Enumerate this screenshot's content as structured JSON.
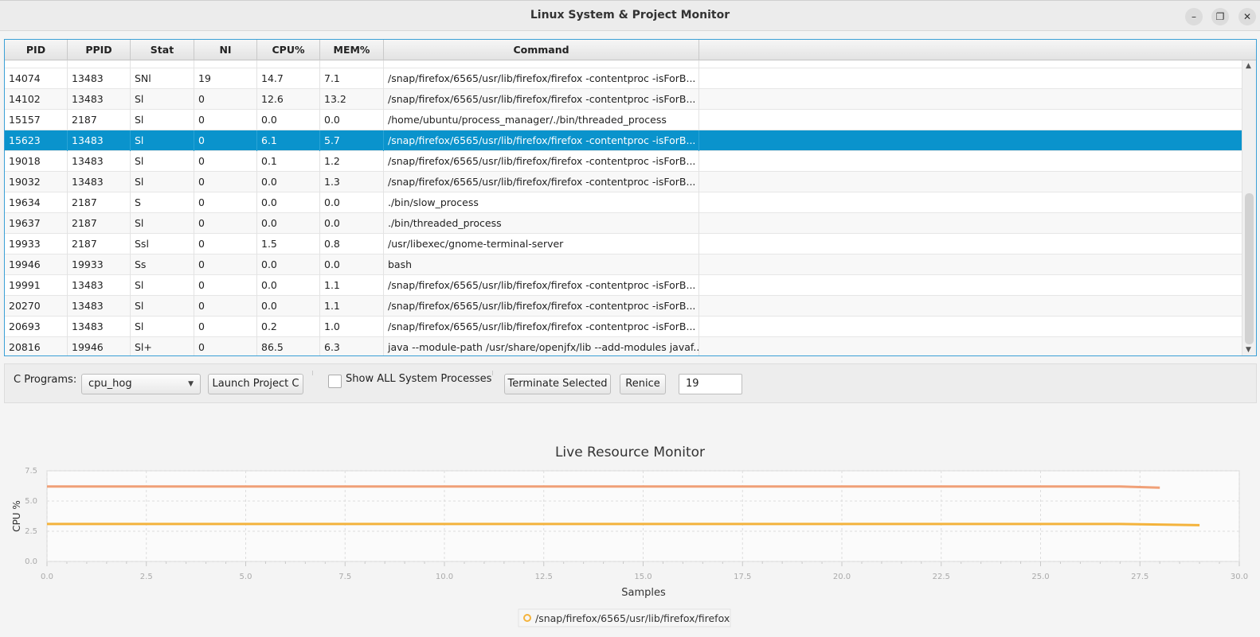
{
  "window": {
    "title": "Linux System & Project Monitor",
    "minimize_glyph": "–",
    "maximize_glyph": "❐",
    "close_glyph": "✕"
  },
  "table": {
    "columns": [
      "PID",
      "PPID",
      "Stat",
      "NI",
      "CPU%",
      "MEM%",
      "Command"
    ],
    "rows": [
      {
        "pid": "14074",
        "ppid": "13483",
        "stat": "SNl",
        "ni": "19",
        "cpu": "14.7",
        "mem": "7.1",
        "cmd": "/snap/firefox/6565/usr/lib/firefox/firefox -contentproc -isForB..."
      },
      {
        "pid": "14102",
        "ppid": "13483",
        "stat": "Sl",
        "ni": "0",
        "cpu": "12.6",
        "mem": "13.2",
        "cmd": "/snap/firefox/6565/usr/lib/firefox/firefox -contentproc -isForB..."
      },
      {
        "pid": "15157",
        "ppid": "2187",
        "stat": "Sl",
        "ni": "0",
        "cpu": "0.0",
        "mem": "0.0",
        "cmd": "/home/ubuntu/process_manager/./bin/threaded_process"
      },
      {
        "pid": "15623",
        "ppid": "13483",
        "stat": "Sl",
        "ni": "0",
        "cpu": "6.1",
        "mem": "5.7",
        "cmd": "/snap/firefox/6565/usr/lib/firefox/firefox -contentproc -isForB..."
      },
      {
        "pid": "19018",
        "ppid": "13483",
        "stat": "Sl",
        "ni": "0",
        "cpu": "0.1",
        "mem": "1.2",
        "cmd": "/snap/firefox/6565/usr/lib/firefox/firefox -contentproc -isForB..."
      },
      {
        "pid": "19032",
        "ppid": "13483",
        "stat": "Sl",
        "ni": "0",
        "cpu": "0.0",
        "mem": "1.3",
        "cmd": "/snap/firefox/6565/usr/lib/firefox/firefox -contentproc -isForB..."
      },
      {
        "pid": "19634",
        "ppid": "2187",
        "stat": "S",
        "ni": "0",
        "cpu": "0.0",
        "mem": "0.0",
        "cmd": "./bin/slow_process"
      },
      {
        "pid": "19637",
        "ppid": "2187",
        "stat": "Sl",
        "ni": "0",
        "cpu": "0.0",
        "mem": "0.0",
        "cmd": "./bin/threaded_process"
      },
      {
        "pid": "19933",
        "ppid": "2187",
        "stat": "Ssl",
        "ni": "0",
        "cpu": "1.5",
        "mem": "0.8",
        "cmd": "/usr/libexec/gnome-terminal-server"
      },
      {
        "pid": "19946",
        "ppid": "19933",
        "stat": "Ss",
        "ni": "0",
        "cpu": "0.0",
        "mem": "0.0",
        "cmd": "bash"
      },
      {
        "pid": "19991",
        "ppid": "13483",
        "stat": "Sl",
        "ni": "0",
        "cpu": "0.0",
        "mem": "1.1",
        "cmd": "/snap/firefox/6565/usr/lib/firefox/firefox -contentproc -isForB..."
      },
      {
        "pid": "20270",
        "ppid": "13483",
        "stat": "Sl",
        "ni": "0",
        "cpu": "0.0",
        "mem": "1.1",
        "cmd": "/snap/firefox/6565/usr/lib/firefox/firefox -contentproc -isForB..."
      },
      {
        "pid": "20693",
        "ppid": "13483",
        "stat": "Sl",
        "ni": "0",
        "cpu": "0.2",
        "mem": "1.0",
        "cmd": "/snap/firefox/6565/usr/lib/firefox/firefox -contentproc -isForB..."
      },
      {
        "pid": "20816",
        "ppid": "19946",
        "stat": "Sl+",
        "ni": "0",
        "cpu": "86.5",
        "mem": "6.3",
        "cmd": "java --module-path /usr/share/openjfx/lib --add-modules javaf..."
      }
    ],
    "selected_pid": "15623",
    "accent_color": "#0a93cc"
  },
  "controls": {
    "programs_label": "C Programs:",
    "program_selected": "cpu_hog",
    "launch_label": "Launch Project C",
    "show_all_label": "Show ALL System Processes",
    "show_all_checked": false,
    "terminate_label": "Terminate Selected",
    "renice_label": "Renice",
    "renice_value": "19"
  },
  "chart_data": {
    "type": "line",
    "title": "Live Resource Monitor",
    "xlabel": "Samples",
    "ylabel": "CPU %",
    "xlim": [
      0,
      30
    ],
    "ylim": [
      0,
      7.5
    ],
    "x_ticks": [
      "0.0",
      "2.5",
      "5.0",
      "7.5",
      "10.0",
      "12.5",
      "15.0",
      "17.5",
      "20.0",
      "22.5",
      "25.0",
      "27.5",
      "30.0"
    ],
    "y_ticks": [
      "0.0",
      "2.5",
      "5.0",
      "7.5"
    ],
    "grid": true,
    "legend_position": "bottom",
    "series": [
      {
        "color": "#f0a077",
        "x": [
          0,
          27,
          28
        ],
        "y": [
          6.2,
          6.2,
          6.1
        ]
      },
      {
        "name": "/snap/firefox/6565/usr/lib/firefox/firefox",
        "color": "#f4b33c",
        "x": [
          0,
          27,
          29
        ],
        "y": [
          3.1,
          3.1,
          3.0
        ]
      }
    ]
  }
}
